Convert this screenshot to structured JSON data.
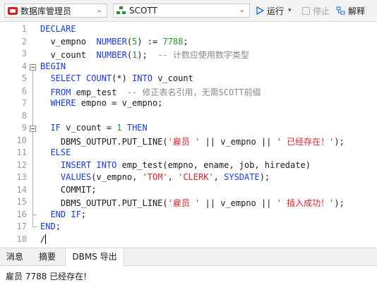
{
  "toolbar": {
    "connection": "数据库管理员",
    "schema": "SCOTT",
    "run_label": "运行",
    "run_icon": "play-icon",
    "stop_label": "停止",
    "explain_label": "解释"
  },
  "editor": {
    "gutter": [
      "1",
      "2",
      "3",
      "4",
      "5",
      "6",
      "7",
      "8",
      "9",
      "10",
      "11",
      "12",
      "13",
      "14",
      "15",
      "16",
      "17",
      "18"
    ],
    "lines": [
      [
        {
          "t": "DECLARE",
          "c": "kw"
        }
      ],
      [
        {
          "t": "  v_empno  ",
          "c": ""
        },
        {
          "t": "NUMBER",
          "c": "kw"
        },
        {
          "t": "(",
          "c": ""
        },
        {
          "t": "5",
          "c": "num"
        },
        {
          "t": ") := ",
          "c": ""
        },
        {
          "t": "7788",
          "c": "num"
        },
        {
          "t": ";",
          "c": ""
        }
      ],
      [
        {
          "t": "  v_count  ",
          "c": ""
        },
        {
          "t": "NUMBER",
          "c": "kw"
        },
        {
          "t": "(",
          "c": ""
        },
        {
          "t": "1",
          "c": "num"
        },
        {
          "t": ");  ",
          "c": ""
        },
        {
          "t": "-- 计数应使用数字类型",
          "c": "cmt"
        }
      ],
      [
        {
          "t": "BEGIN",
          "c": "kw"
        }
      ],
      [
        {
          "t": "  ",
          "c": ""
        },
        {
          "t": "SELECT COUNT",
          "c": "kw"
        },
        {
          "t": "(*) ",
          "c": ""
        },
        {
          "t": "INTO",
          "c": "kw"
        },
        {
          "t": " v_count",
          "c": ""
        }
      ],
      [
        {
          "t": "  ",
          "c": ""
        },
        {
          "t": "FROM",
          "c": "kw"
        },
        {
          "t": " emp_test  ",
          "c": ""
        },
        {
          "t": "-- 修正表名引用，无需SCOTT前缀",
          "c": "cmt"
        }
      ],
      [
        {
          "t": "  ",
          "c": ""
        },
        {
          "t": "WHERE",
          "c": "kw"
        },
        {
          "t": " empno = v_empno;",
          "c": ""
        }
      ],
      [],
      [
        {
          "t": "  ",
          "c": ""
        },
        {
          "t": "IF",
          "c": "kw"
        },
        {
          "t": " v_count = ",
          "c": ""
        },
        {
          "t": "1",
          "c": "num"
        },
        {
          "t": " ",
          "c": ""
        },
        {
          "t": "THEN",
          "c": "kw"
        }
      ],
      [
        {
          "t": "    DBMS_OUTPUT.PUT_LINE(",
          "c": ""
        },
        {
          "t": "'雇员 '",
          "c": "str"
        },
        {
          "t": " || v_empno || ",
          "c": ""
        },
        {
          "t": "' 已经存在！'",
          "c": "str"
        },
        {
          "t": ");",
          "c": ""
        }
      ],
      [
        {
          "t": "  ",
          "c": ""
        },
        {
          "t": "ELSE",
          "c": "kw"
        }
      ],
      [
        {
          "t": "    ",
          "c": ""
        },
        {
          "t": "INSERT INTO",
          "c": "kw"
        },
        {
          "t": " emp_test(empno, ename, job, hiredate)",
          "c": ""
        }
      ],
      [
        {
          "t": "    ",
          "c": ""
        },
        {
          "t": "VALUES",
          "c": "kw"
        },
        {
          "t": "(v_empno, ",
          "c": ""
        },
        {
          "t": "'TOM'",
          "c": "str"
        },
        {
          "t": ", ",
          "c": ""
        },
        {
          "t": "'CLERK'",
          "c": "str"
        },
        {
          "t": ", ",
          "c": ""
        },
        {
          "t": "SYSDATE",
          "c": "kw"
        },
        {
          "t": ");",
          "c": ""
        }
      ],
      [
        {
          "t": "    COMMIT;",
          "c": ""
        }
      ],
      [
        {
          "t": "    DBMS_OUTPUT.PUT_LINE(",
          "c": ""
        },
        {
          "t": "'雇员 '",
          "c": "str"
        },
        {
          "t": " || v_empno || ",
          "c": ""
        },
        {
          "t": "' 插入成功！'",
          "c": "str"
        },
        {
          "t": ");",
          "c": ""
        }
      ],
      [
        {
          "t": "  ",
          "c": ""
        },
        {
          "t": "END IF",
          "c": "kw"
        },
        {
          "t": ";",
          "c": ""
        }
      ],
      [
        {
          "t": "END",
          "c": "kw"
        },
        {
          "t": ";",
          "c": ""
        }
      ],
      [
        {
          "t": "/",
          "c": ""
        }
      ]
    ]
  },
  "tabs": [
    {
      "label": "消息",
      "active": false
    },
    {
      "label": "摘要",
      "active": false
    },
    {
      "label": "DBMS 导出",
      "active": true
    }
  ],
  "output": {
    "text": "雇员 7788 已经存在!"
  }
}
